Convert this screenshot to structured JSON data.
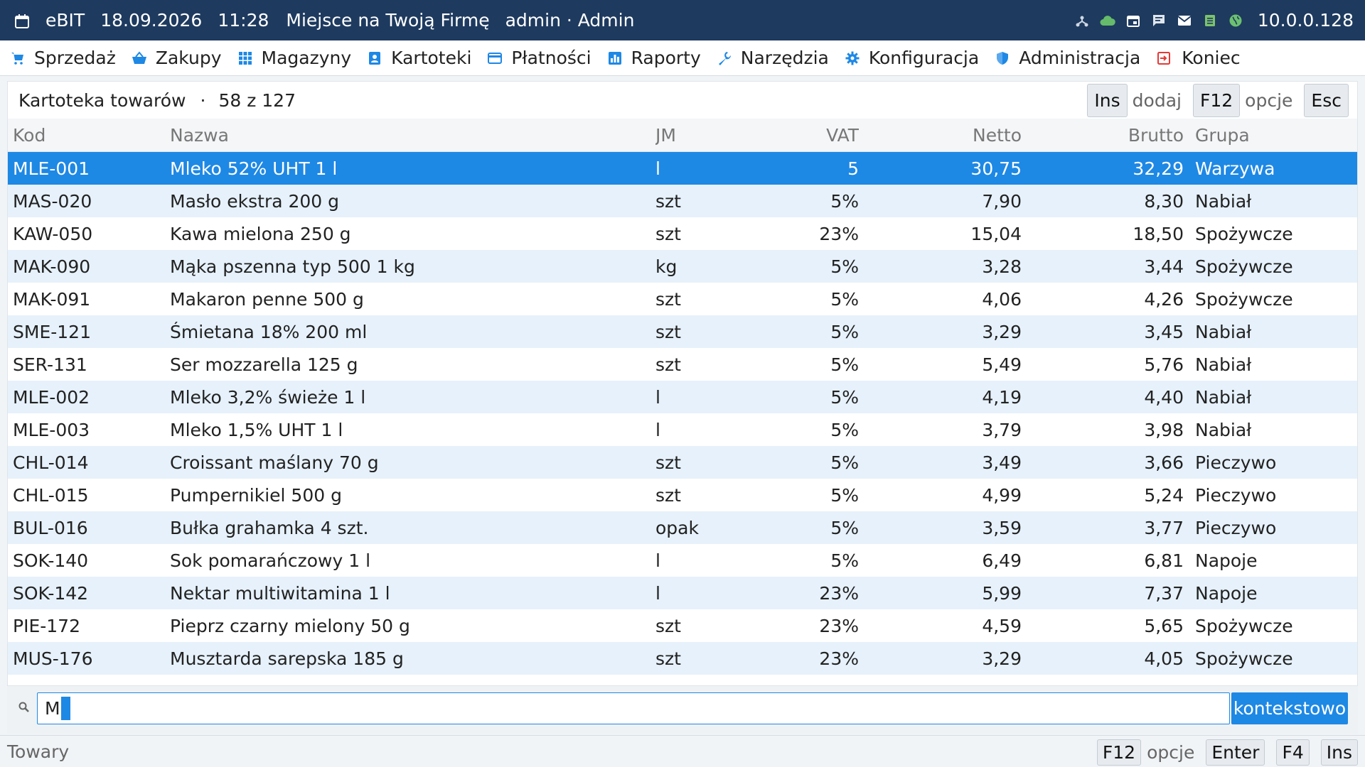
{
  "titlebar": {
    "app": "eBIT",
    "date": "18.09.2026",
    "time": "11:28",
    "company": "Miejsce na Twoją Firmę",
    "user": "admin · Admin",
    "ip": "10.0.0.128"
  },
  "menu": [
    {
      "label": "Sprzedaż",
      "icon": "cart-icon"
    },
    {
      "label": "Zakupy",
      "icon": "basket-icon"
    },
    {
      "label": "Magazyny",
      "icon": "grid-icon"
    },
    {
      "label": "Kartoteki",
      "icon": "contact-card-icon"
    },
    {
      "label": "Płatności",
      "icon": "credit-card-icon"
    },
    {
      "label": "Raporty",
      "icon": "bar-chart-icon"
    },
    {
      "label": "Narzędzia",
      "icon": "wrench-icon"
    },
    {
      "label": "Konfiguracja",
      "icon": "gear-icon"
    },
    {
      "label": "Administracja",
      "icon": "shield-icon"
    },
    {
      "label": "Koniec",
      "icon": "exit-icon"
    }
  ],
  "panel": {
    "title": "Kartoteka towarów",
    "separator": "·",
    "count": "58 z 127",
    "ins_key": "Ins",
    "ins_label": "dodaj",
    "f12_key": "F12",
    "f12_label": "opcje",
    "esc_key": "Esc"
  },
  "table": {
    "headers": {
      "kod": "Kod",
      "nazwa": "Nazwa",
      "jm": "JM",
      "vat": "VAT",
      "netto": "Netto",
      "brutto": "Brutto",
      "grupa": "Grupa"
    },
    "rows": [
      {
        "kod": "MLE-001",
        "nazwa": "Mleko 52% UHT 1 l",
        "jm": "l",
        "vat": "5",
        "netto": "30,75",
        "brutto": "32,29",
        "grupa": "Warzywa"
      },
      {
        "kod": "MAS-020",
        "nazwa": "Masło ekstra 200 g",
        "jm": "szt",
        "vat": "5%",
        "netto": "7,90",
        "brutto": "8,30",
        "grupa": "Nabiał"
      },
      {
        "kod": "KAW-050",
        "nazwa": "Kawa mielona 250 g",
        "jm": "szt",
        "vat": "23%",
        "netto": "15,04",
        "brutto": "18,50",
        "grupa": "Spożywcze"
      },
      {
        "kod": "MAK-090",
        "nazwa": "Mąka pszenna typ 500 1 kg",
        "jm": "kg",
        "vat": "5%",
        "netto": "3,28",
        "brutto": "3,44",
        "grupa": "Spożywcze"
      },
      {
        "kod": "MAK-091",
        "nazwa": "Makaron penne 500 g",
        "jm": "szt",
        "vat": "5%",
        "netto": "4,06",
        "brutto": "4,26",
        "grupa": "Spożywcze"
      },
      {
        "kod": "SME-121",
        "nazwa": "Śmietana 18% 200 ml",
        "jm": "szt",
        "vat": "5%",
        "netto": "3,29",
        "brutto": "3,45",
        "grupa": "Nabiał"
      },
      {
        "kod": "SER-131",
        "nazwa": "Ser mozzarella 125 g",
        "jm": "szt",
        "vat": "5%",
        "netto": "5,49",
        "brutto": "5,76",
        "grupa": "Nabiał"
      },
      {
        "kod": "MLE-002",
        "nazwa": "Mleko 3,2% świeże 1 l",
        "jm": "l",
        "vat": "5%",
        "netto": "4,19",
        "brutto": "4,40",
        "grupa": "Nabiał"
      },
      {
        "kod": "MLE-003",
        "nazwa": "Mleko 1,5% UHT 1 l",
        "jm": "l",
        "vat": "5%",
        "netto": "3,79",
        "brutto": "3,98",
        "grupa": "Nabiał"
      },
      {
        "kod": "CHL-014",
        "nazwa": "Croissant maślany 70 g",
        "jm": "szt",
        "vat": "5%",
        "netto": "3,49",
        "brutto": "3,66",
        "grupa": "Pieczywo"
      },
      {
        "kod": "CHL-015",
        "nazwa": "Pumpernikiel 500 g",
        "jm": "szt",
        "vat": "5%",
        "netto": "4,99",
        "brutto": "5,24",
        "grupa": "Pieczywo"
      },
      {
        "kod": "BUL-016",
        "nazwa": "Bułka grahamka 4 szt.",
        "jm": "opak",
        "vat": "5%",
        "netto": "3,59",
        "brutto": "3,77",
        "grupa": "Pieczywo"
      },
      {
        "kod": "SOK-140",
        "nazwa": "Sok pomarańczowy 1 l",
        "jm": "l",
        "vat": "5%",
        "netto": "6,49",
        "brutto": "6,81",
        "grupa": "Napoje"
      },
      {
        "kod": "SOK-142",
        "nazwa": "Nektar multiwitamina 1 l",
        "jm": "l",
        "vat": "23%",
        "netto": "5,99",
        "brutto": "7,37",
        "grupa": "Napoje"
      },
      {
        "kod": "PIE-172",
        "nazwa": "Pieprz czarny mielony 50 g",
        "jm": "szt",
        "vat": "23%",
        "netto": "4,59",
        "brutto": "5,65",
        "grupa": "Spożywcze"
      },
      {
        "kod": "MUS-176",
        "nazwa": "Musztarda sarepska 185 g",
        "jm": "szt",
        "vat": "23%",
        "netto": "3,29",
        "brutto": "4,05",
        "grupa": "Spożywcze"
      }
    ]
  },
  "search": {
    "value": "M",
    "button_label": "kontekstowo"
  },
  "statusbar": {
    "text": "Towary",
    "f12_key": "F12",
    "f12_label": "opcje",
    "enter_key": "Enter",
    "f4_key": "F4",
    "ins_key": "Ins"
  },
  "colors": {
    "titlebar": "#1e3a5f",
    "accent": "#1e88e5",
    "row_alt": "#e6f1fb",
    "icon_blue": "#1e88e5",
    "icon_green": "#66bb6a",
    "icon_red": "#e53935"
  }
}
